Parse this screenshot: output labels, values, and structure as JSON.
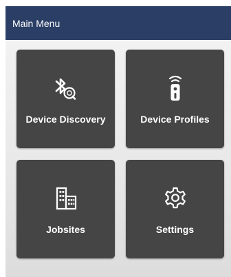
{
  "appbar": {
    "title": "Main Menu"
  },
  "menu": {
    "tiles": [
      {
        "label": "Device Discovery",
        "icon": "bluetooth-search-icon"
      },
      {
        "label": "Device Profiles",
        "icon": "remote-control-icon"
      },
      {
        "label": "Jobsites",
        "icon": "building-icon"
      },
      {
        "label": "Settings",
        "icon": "gear-icon"
      }
    ]
  },
  "colors": {
    "appbar_background": "#2b3f66",
    "tile_background": "#454545",
    "content_background": "#ebebeb",
    "text_light": "#ffffff"
  }
}
